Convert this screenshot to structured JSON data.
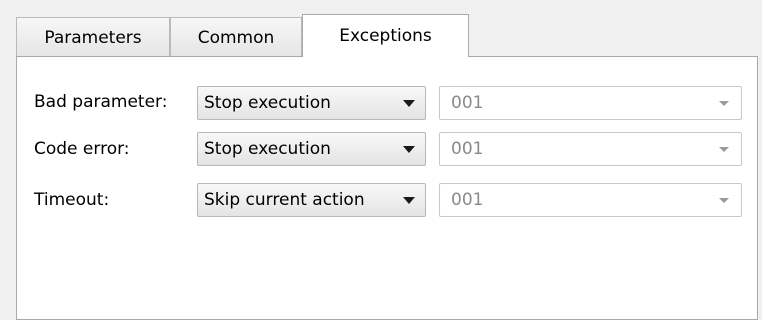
{
  "tabs": [
    {
      "label": "Parameters",
      "active": false
    },
    {
      "label": "Common",
      "active": false
    },
    {
      "label": "Exceptions",
      "active": true
    }
  ],
  "exceptions": {
    "rows": [
      {
        "label": "Bad parameter:",
        "action": "Stop execution",
        "code": "001"
      },
      {
        "label": "Code error:",
        "action": "Stop execution",
        "code": "001"
      },
      {
        "label": "Timeout:",
        "action": "Skip current action",
        "code": "001"
      }
    ]
  },
  "icons": {
    "action_dropdown": "dropdown-arrow-icon",
    "code_dropdown": "dropdown-arrow-icon"
  },
  "colors": {
    "background": "#f0f0f0",
    "panel": "#ffffff",
    "disabled_text": "#8a8a8a"
  }
}
